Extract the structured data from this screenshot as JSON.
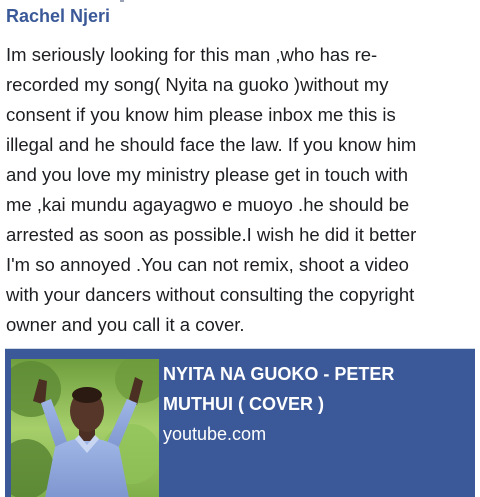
{
  "post": {
    "author": "Rachel Njeri",
    "text_lines": [
      "Im seriously looking for this man ,who has re-",
      "recorded my song( Nyita na guoko )without  my",
      "consent if  you know him  please  inbox me this is",
      "illegal and he should face the  law. If  you know him",
      "and you love my ministry please get in touch with",
      "me ,kai mundu  agayagwo e muoyo .he should be",
      "arrested as  soon as possible.I wish he did it better",
      "I'm so annoyed .You can not remix,  shoot a video",
      "with your dancers without consulting the copyright",
      "owner and you call it a cover."
    ]
  },
  "link_preview": {
    "title_lines": [
      "NYITA NA GUOKO  - PETER",
      "MUTHUI ( COVER )"
    ],
    "domain": "youtube.com",
    "card_color": "#3b5998"
  },
  "colors": {
    "author": "#3b5998",
    "text": "#1c1e21"
  }
}
